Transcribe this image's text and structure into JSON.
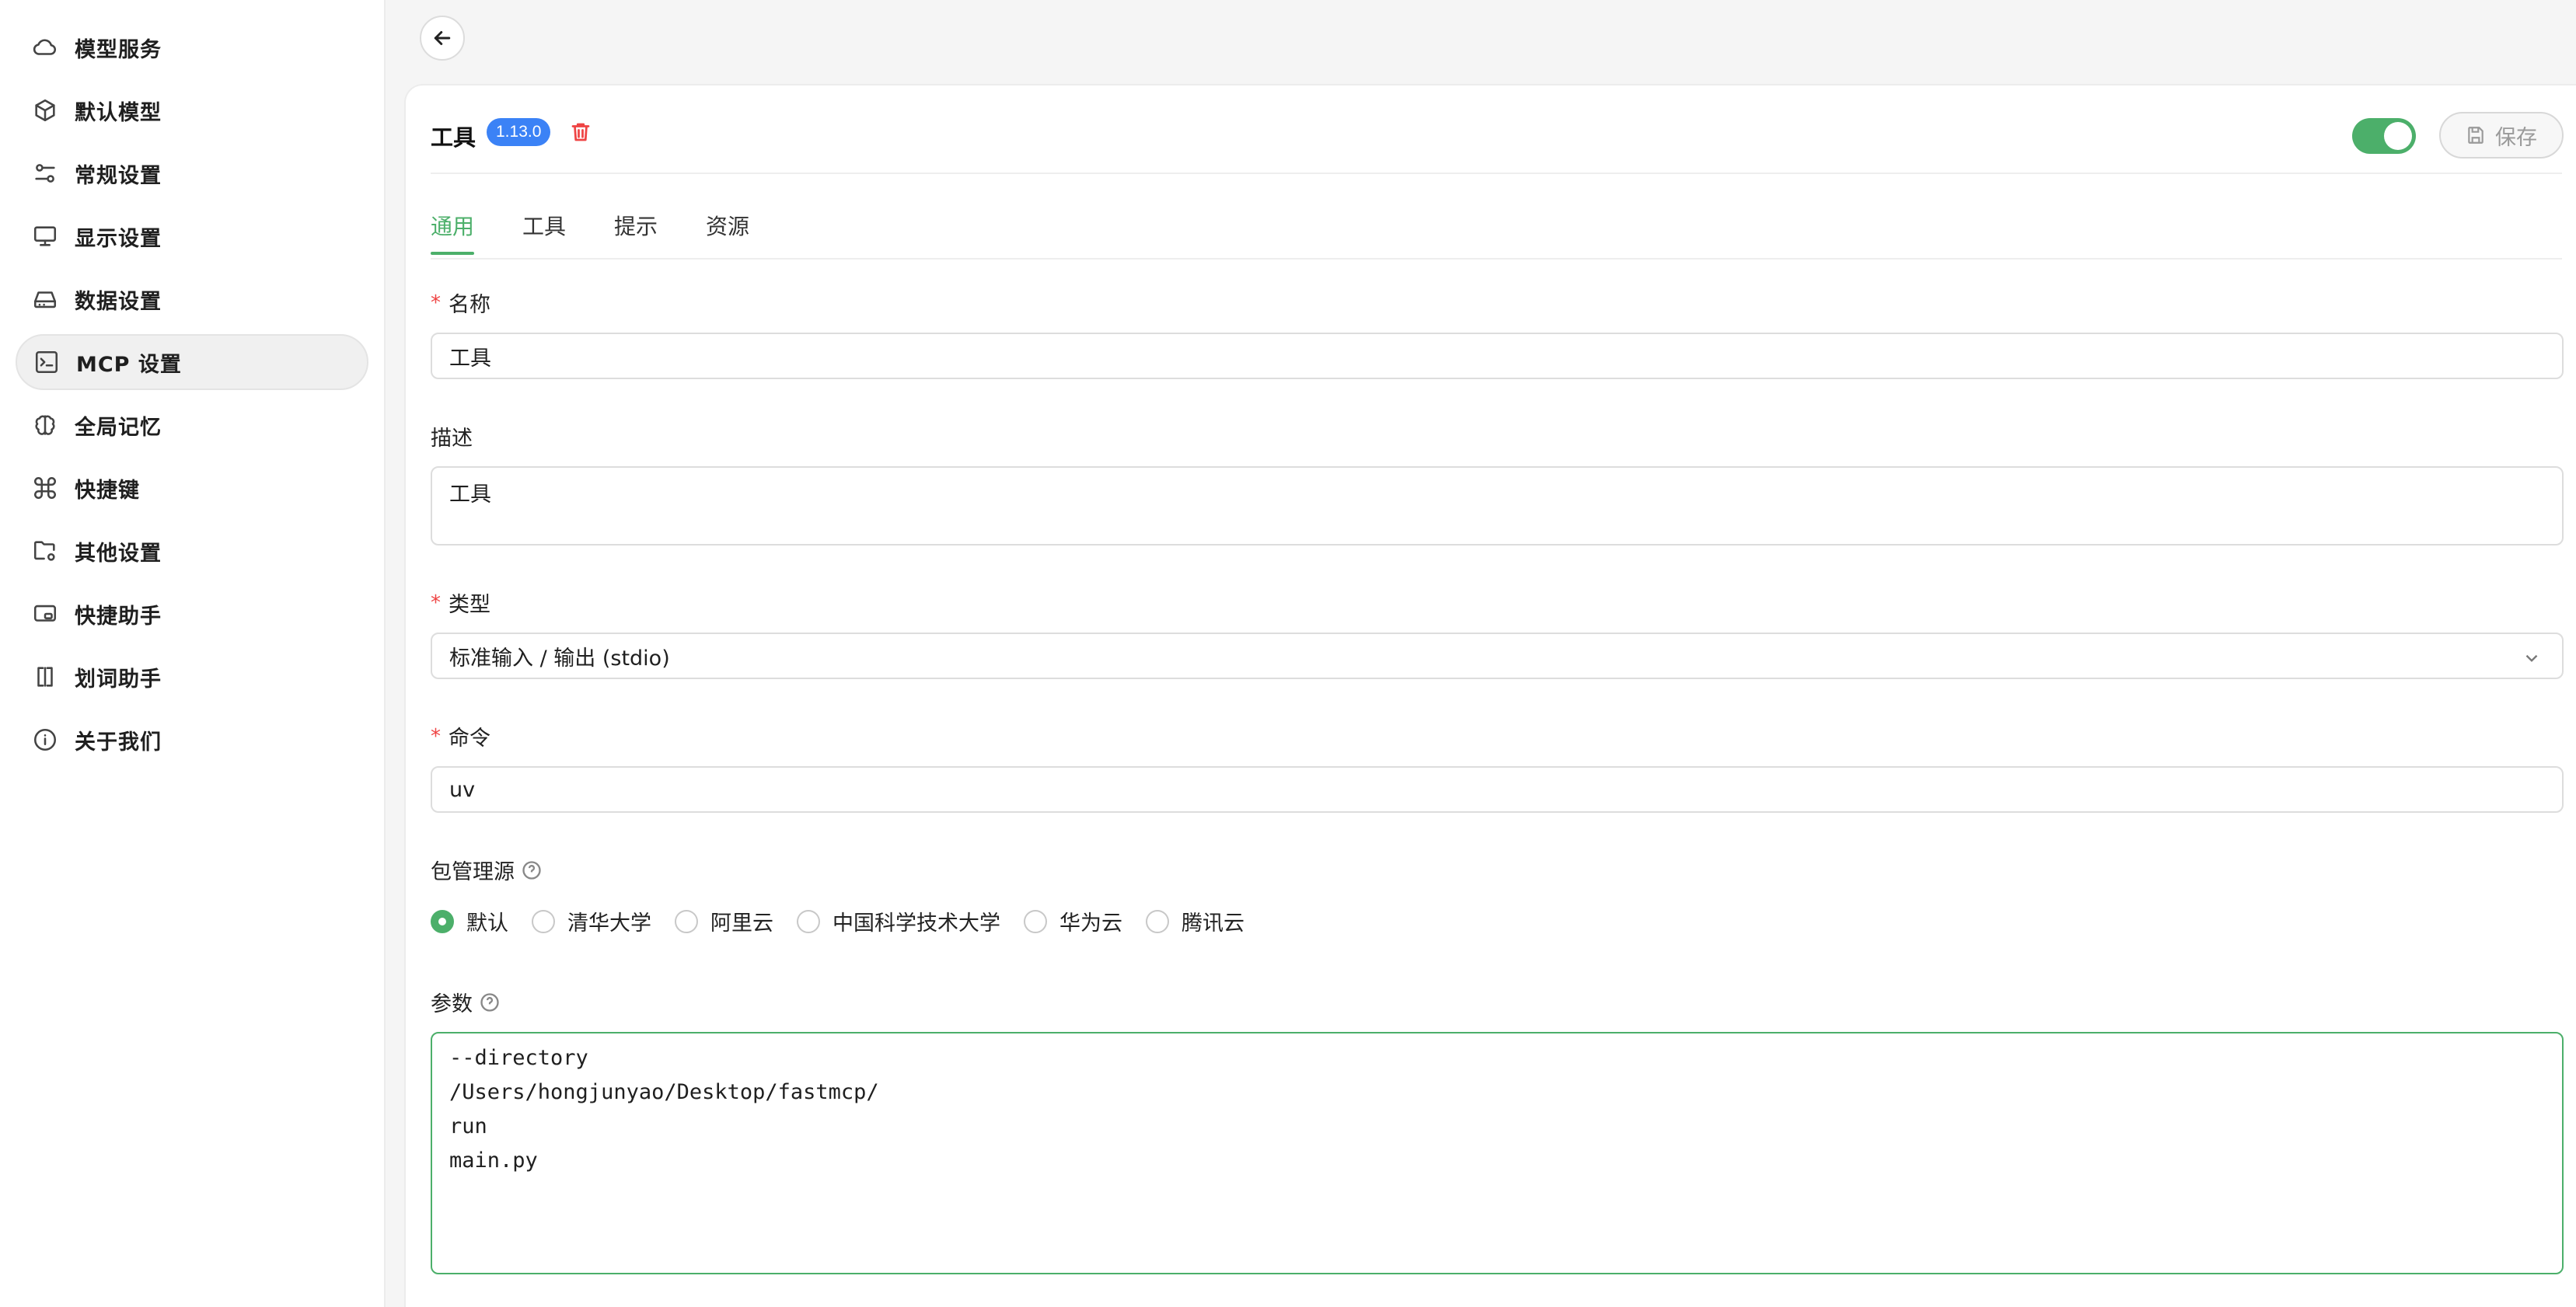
{
  "sidebar": {
    "items": [
      {
        "label": "模型服务",
        "icon": "cloud-icon"
      },
      {
        "label": "默认模型",
        "icon": "cube-icon"
      },
      {
        "label": "常规设置",
        "icon": "settings-sliders-icon"
      },
      {
        "label": "显示设置",
        "icon": "monitor-icon"
      },
      {
        "label": "数据设置",
        "icon": "hard-drive-icon"
      },
      {
        "label": "MCP 设置",
        "icon": "terminal-icon",
        "active": true
      },
      {
        "label": "全局记忆",
        "icon": "brain-icon"
      },
      {
        "label": "快捷键",
        "icon": "command-icon"
      },
      {
        "label": "其他设置",
        "icon": "folder-cog-icon"
      },
      {
        "label": "快捷助手",
        "icon": "window-icon"
      },
      {
        "label": "划词助手",
        "icon": "text-cursor-icon"
      },
      {
        "label": "关于我们",
        "icon": "info-icon"
      }
    ]
  },
  "header": {
    "title": "工具",
    "version": "1.13.0",
    "enabled": true,
    "save_label": "保存"
  },
  "tabs": [
    {
      "label": "通用",
      "active": true
    },
    {
      "label": "工具"
    },
    {
      "label": "提示"
    },
    {
      "label": "资源"
    }
  ],
  "form": {
    "name": {
      "label": "名称",
      "required": true,
      "value": "工具"
    },
    "description": {
      "label": "描述",
      "value": "工具"
    },
    "type": {
      "label": "类型",
      "required": true,
      "value": "标准输入 / 输出 (stdio)"
    },
    "command": {
      "label": "命令",
      "required": true,
      "value": "uv"
    },
    "registry": {
      "label": "包管理源",
      "options": [
        "默认",
        "清华大学",
        "阿里云",
        "中国科学技术大学",
        "华为云",
        "腾讯云"
      ],
      "selected": "默认"
    },
    "args": {
      "label": "参数",
      "lines": [
        "--directory",
        "/Users/hongjunyao/Desktop/fastmcp/",
        "run",
        "main.py"
      ]
    }
  },
  "colors": {
    "accent": "#4caf6a",
    "badge": "#3b82f6",
    "danger": "#ef4444"
  }
}
